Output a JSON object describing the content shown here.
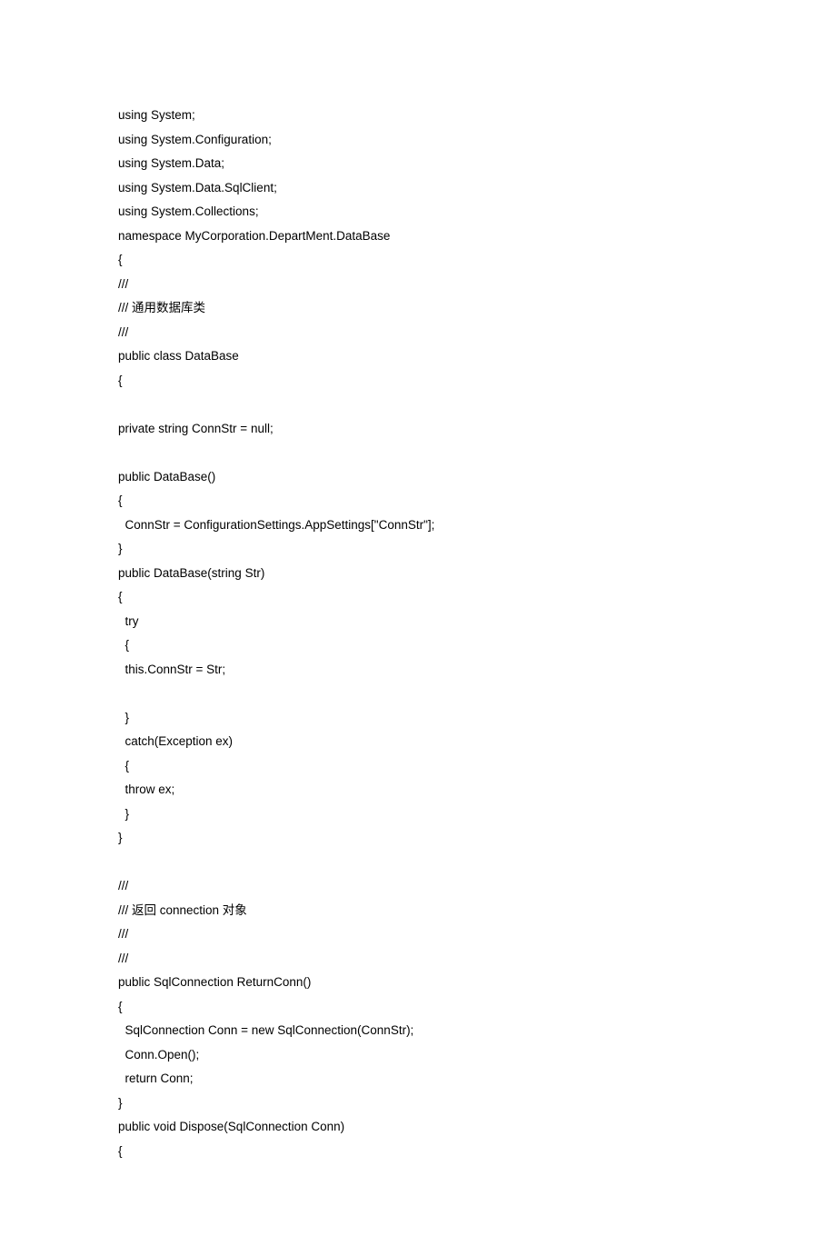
{
  "code": {
    "lines": [
      "using System;",
      "using System.Configuration;",
      "using System.Data;",
      "using System.Data.SqlClient;",
      "using System.Collections;",
      "namespace MyCorporation.DepartMent.DataBase",
      "{",
      "///",
      "/// 通用数据库类",
      "///",
      "public class DataBase",
      "{",
      "",
      "private string ConnStr = null;",
      "",
      "public DataBase()",
      "{",
      "  ConnStr = ConfigurationSettings.AppSettings[\"ConnStr\"];",
      "}",
      "public DataBase(string Str)",
      "{",
      "  try",
      "  {",
      "  this.ConnStr = Str;",
      "",
      "  }",
      "  catch(Exception ex)",
      "  {",
      "  throw ex;",
      "  }",
      "}",
      "",
      "///",
      "/// 返回 connection 对象",
      "///",
      "///",
      "public SqlConnection ReturnConn()",
      "{",
      "  SqlConnection Conn = new SqlConnection(ConnStr);",
      "  Conn.Open();",
      "  return Conn;",
      "}",
      "public void Dispose(SqlConnection Conn)",
      "{"
    ]
  }
}
